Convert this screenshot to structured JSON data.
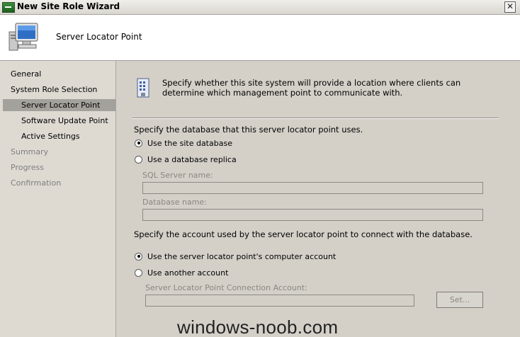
{
  "window": {
    "title": "New Site Role Wizard",
    "close_glyph": "✕"
  },
  "header": {
    "title": "Server Locator Point",
    "icon": "computer-icon"
  },
  "nav": {
    "items": [
      {
        "label": "General",
        "level": 1,
        "state": "normal"
      },
      {
        "label": "System Role Selection",
        "level": 1,
        "state": "normal"
      },
      {
        "label": "Server Locator Point",
        "level": 2,
        "state": "selected"
      },
      {
        "label": "Software Update Point",
        "level": 2,
        "state": "normal"
      },
      {
        "label": "Active Settings",
        "level": 2,
        "state": "normal"
      },
      {
        "label": "Summary",
        "level": 1,
        "state": "disabled"
      },
      {
        "label": "Progress",
        "level": 1,
        "state": "disabled"
      },
      {
        "label": "Confirmation",
        "level": 1,
        "state": "disabled"
      }
    ]
  },
  "main": {
    "intro": "Specify whether this site system will provide a location where clients can determine which management point to communicate with.",
    "database_prompt": "Specify the database that this server locator point uses.",
    "use_site_database": "Use the site database",
    "use_replica": "Use a database replica",
    "sql_server_label": "SQL Server name:",
    "sql_server_value": "",
    "database_name_label": "Database name:",
    "database_name_value": "",
    "account_prompt": "Specify the account used by the server locator point to connect with the database.",
    "use_computer_account": "Use the server locator point's computer account",
    "use_another_account": "Use another account",
    "connection_account_label": "Server Locator Point Connection Account:",
    "connection_account_value": "",
    "set_button": "Set...",
    "database_choice": "site",
    "account_choice": "computer"
  },
  "watermark": "windows-noob.com"
}
